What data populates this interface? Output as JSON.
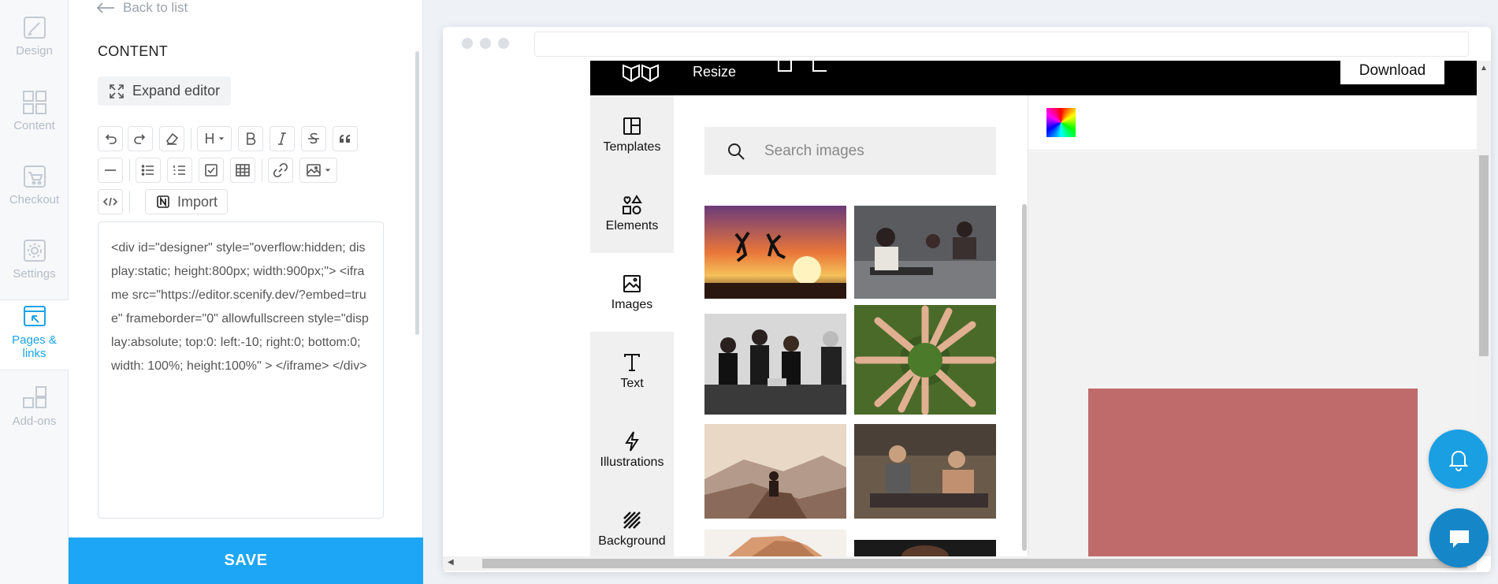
{
  "rail": {
    "items": [
      {
        "label": "Design",
        "icon": "brush-icon"
      },
      {
        "label": "Content",
        "icon": "grid-icon"
      },
      {
        "label": "Checkout",
        "icon": "cart-icon"
      },
      {
        "label": "Settings",
        "icon": "gear-icon"
      },
      {
        "label": "Pages & links",
        "icon": "pages-icon",
        "active": true
      },
      {
        "label": "Add-ons",
        "icon": "addons-icon"
      }
    ]
  },
  "panel": {
    "back_label": "Back to list",
    "title": "CONTENT",
    "expand_label": "Expand editor",
    "toolbar": {
      "heading_label": "H",
      "import_label": "Import"
    },
    "code": "<div id=\"designer\" style=\"overflow:hidden; display:static; height:800px; width:900px;\"> <iframe src=\"https://editor.scenify.dev/?embed=true\" frameborder=\"0\" allowfullscreen style=\"display:absolute; top:0: left:-10; right:0; bottom:0; width: 100%; height:100%\" > </iframe> </div>",
    "save_label": "SAVE"
  },
  "preview": {
    "topbar": {
      "resize_label": "Resize",
      "download_label": "Download"
    },
    "sidebar": [
      {
        "label": "Templates",
        "icon": "templates-icon"
      },
      {
        "label": "Elements",
        "icon": "elements-icon"
      },
      {
        "label": "Images",
        "icon": "images-icon",
        "active": true
      },
      {
        "label": "Text",
        "icon": "text-icon"
      },
      {
        "label": "Illustrations",
        "icon": "lightning-icon"
      },
      {
        "label": "Background",
        "icon": "hatch-icon"
      }
    ],
    "search_placeholder": "Search images",
    "colors": {
      "accent": "#1da6f5",
      "shape": "#c06b6b",
      "topbar": "#000000"
    }
  }
}
